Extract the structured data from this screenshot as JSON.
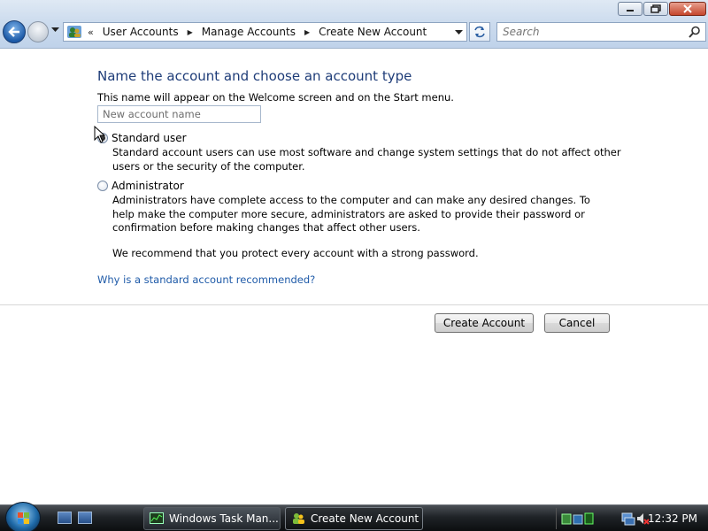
{
  "window": {
    "minimize_label": "",
    "maximize_label": "",
    "close_label": ""
  },
  "address_bar": {
    "chevron": "«",
    "breadcrumbs": [
      "User Accounts",
      "Manage Accounts",
      "Create New Account"
    ]
  },
  "search": {
    "placeholder": "Search"
  },
  "page": {
    "heading": "Name the account and choose an account type",
    "subtext": "This name will appear on the Welcome screen and on the Start menu.",
    "name_input": {
      "value": "",
      "placeholder": "New account name"
    },
    "options": [
      {
        "label": "Standard user",
        "checked": true,
        "description": "Standard account users can use most software and change system settings that do not affect other users or the security of the computer."
      },
      {
        "label": "Administrator",
        "checked": false,
        "description": "Administrators have complete access to the computer and can make any desired changes. To help make the computer more secure, administrators are asked to provide their password or confirmation before making changes that affect other users."
      }
    ],
    "recommendation": "We recommend that you protect every account with a strong password.",
    "help_link": "Why is a standard account recommended?",
    "buttons": {
      "create": "Create Account",
      "cancel": "Cancel"
    }
  },
  "taskbar": {
    "tasks": [
      {
        "label": "Windows Task Man...",
        "icon": "task-manager-icon",
        "active": false
      },
      {
        "label": "Create New Account",
        "icon": "user-accounts-icon",
        "active": true
      }
    ],
    "clock": "12:32 PM"
  },
  "colors": {
    "heading": "#1e3c78",
    "link": "#1e5aa8",
    "chrome": "#cddcee",
    "taskbar": "#1f2327"
  }
}
